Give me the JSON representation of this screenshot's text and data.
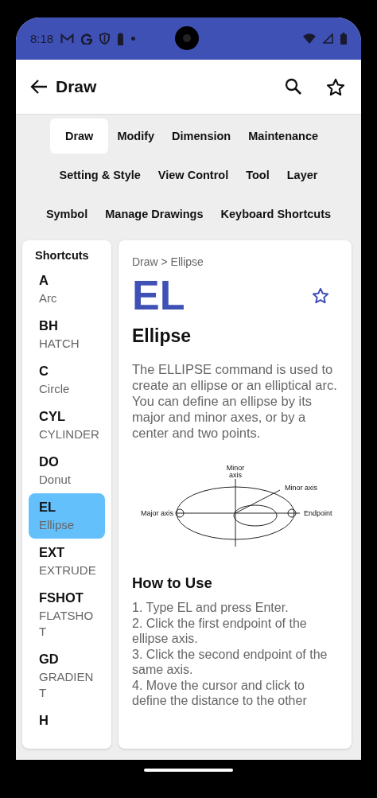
{
  "status_bar": {
    "time": "8:18"
  },
  "app_bar": {
    "title": "Draw"
  },
  "category_rows": [
    [
      {
        "label": "Draw",
        "selected": true
      },
      {
        "label": "Modify",
        "selected": false
      },
      {
        "label": "Dimension",
        "selected": false
      },
      {
        "label": "Maintenance",
        "selected": false
      }
    ],
    [
      {
        "label": "Setting & Style",
        "selected": false
      },
      {
        "label": "View Control",
        "selected": false
      },
      {
        "label": "Tool",
        "selected": false
      },
      {
        "label": "Layer",
        "selected": false
      }
    ],
    [
      {
        "label": "Symbol",
        "selected": false
      },
      {
        "label": "Manage Drawings",
        "selected": false
      },
      {
        "label": "Keyboard Shortcuts",
        "selected": false
      }
    ]
  ],
  "sidebar": {
    "title": "Shortcuts",
    "items": [
      {
        "key": "A",
        "name": "Arc",
        "selected": false
      },
      {
        "key": "BH",
        "name": "HATCH",
        "selected": false
      },
      {
        "key": "C",
        "name": "Circle",
        "selected": false
      },
      {
        "key": "CYL",
        "name": "CYLINDER",
        "selected": false
      },
      {
        "key": "DO",
        "name": "Donut",
        "selected": false
      },
      {
        "key": "EL",
        "name": "Ellipse",
        "selected": true
      },
      {
        "key": "EXT",
        "name": "EXTRUDE",
        "selected": false
      },
      {
        "key": "FSHOT",
        "name": "FLATSHOT",
        "selected": false
      },
      {
        "key": "GD",
        "name": "GRADIENT",
        "selected": false
      },
      {
        "key": "H"
      }
    ]
  },
  "detail": {
    "breadcrumb": "Draw > Ellipse",
    "shortcut": "EL",
    "title": "Ellipse",
    "description": "The ELLIPSE command is used to create an ellipse or an elliptical arc. You can define an ellipse by its major and minor axes, or by a center and two points.",
    "diagram": {
      "top_label": "Minor axis",
      "leader_label": "Minor axis",
      "left_label": "Major axis",
      "right_label": "Endpoint"
    },
    "how_to_title": "How to Use",
    "steps": [
      "1. Type EL and press Enter.",
      "2. Click the first endpoint of the ellipse axis.",
      "3. Click the second endpoint of the same axis.",
      "4. Move the cursor and click to define the distance to the other"
    ]
  }
}
